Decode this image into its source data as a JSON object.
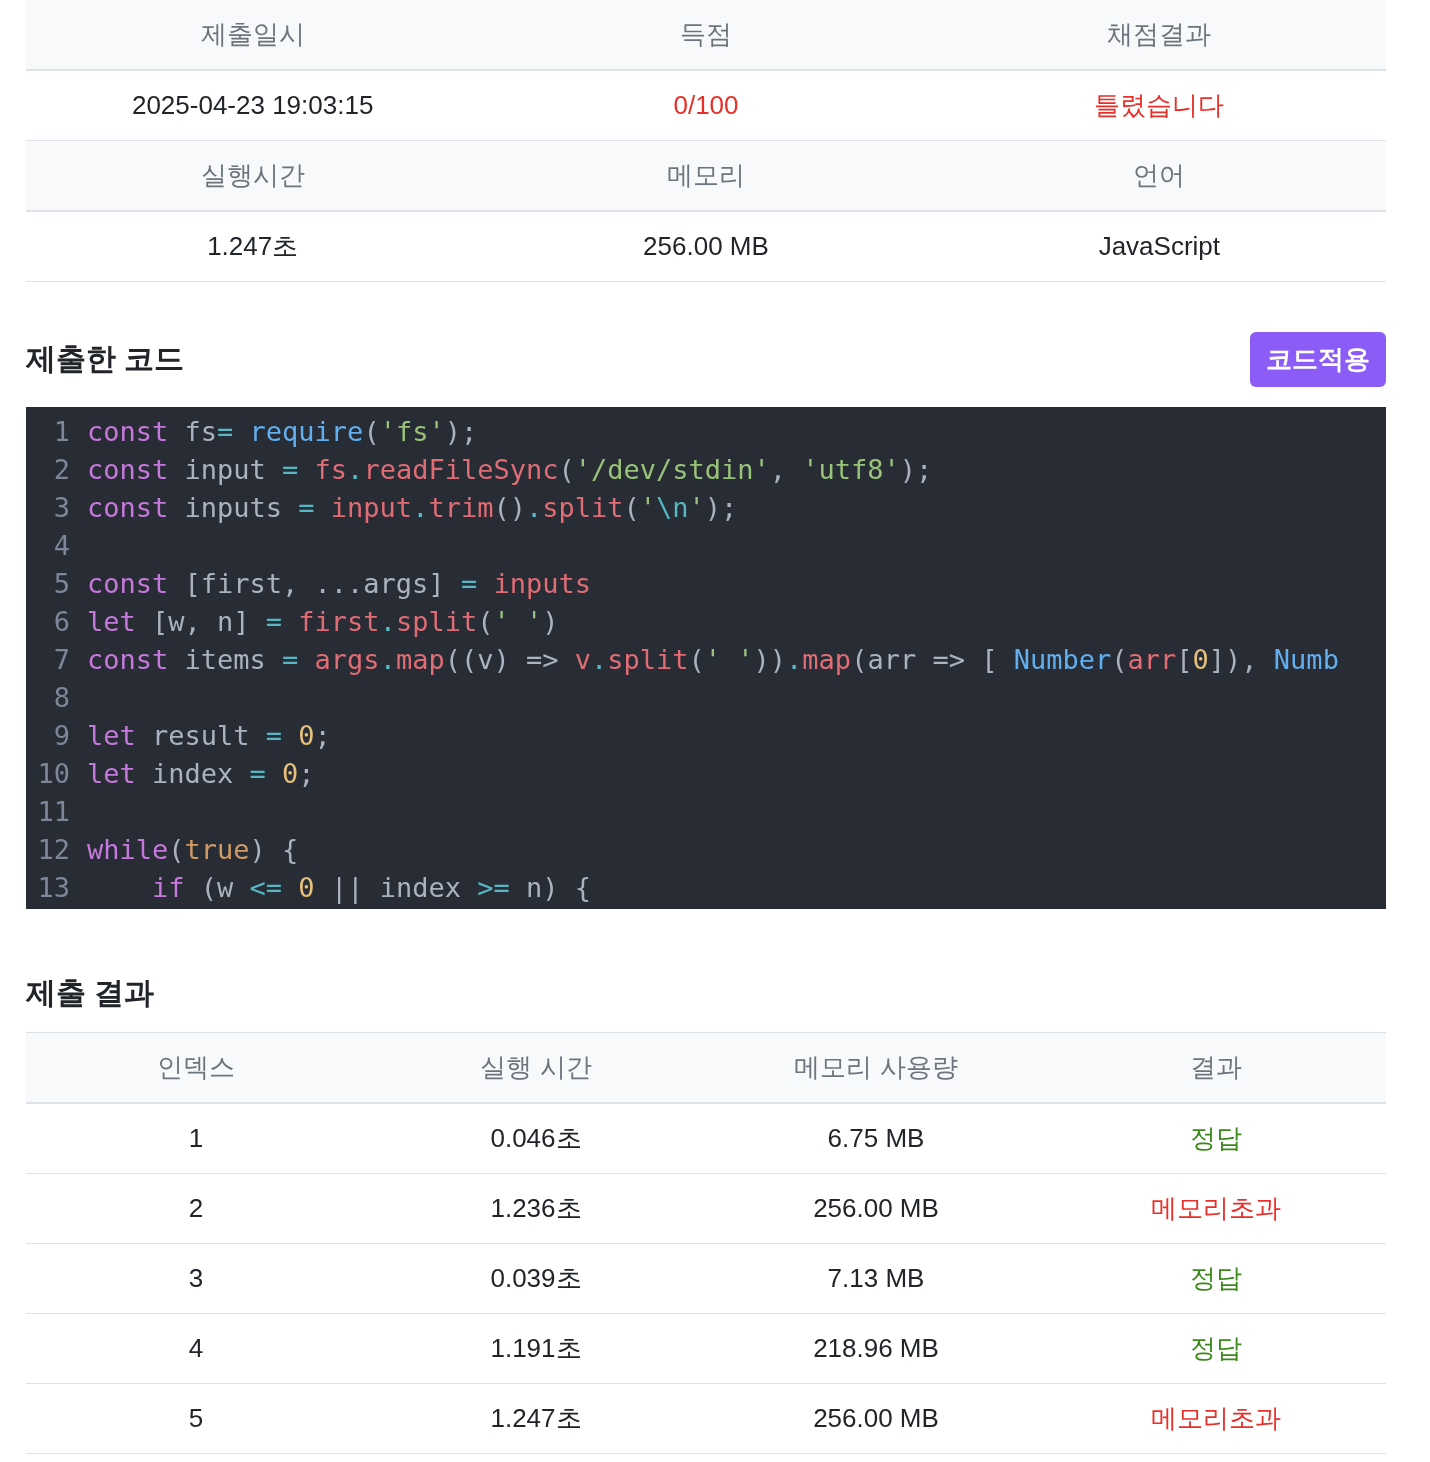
{
  "summary_table": {
    "rows": [
      {
        "kind": "header",
        "cells": [
          {
            "text": "제출일시"
          },
          {
            "text": "득점"
          },
          {
            "text": "채점결과"
          }
        ]
      },
      {
        "kind": "data",
        "cells": [
          {
            "text": "2025-04-23 19:03:15"
          },
          {
            "text": "0/100",
            "color": "#e8302a"
          },
          {
            "text": "틀렸습니다",
            "color": "#e8302a"
          }
        ]
      },
      {
        "kind": "header",
        "cells": [
          {
            "text": "실행시간"
          },
          {
            "text": "메모리"
          },
          {
            "text": "언어"
          }
        ]
      },
      {
        "kind": "data",
        "cells": [
          {
            "text": "1.247초"
          },
          {
            "text": "256.00 MB"
          },
          {
            "text": "JavaScript"
          }
        ]
      }
    ]
  },
  "code_section": {
    "title": "제출한 코드",
    "button": "코드적용",
    "lines": [
      {
        "number": "1",
        "tokens": [
          {
            "kind": "keyword",
            "text": "const"
          },
          {
            "kind": "plain",
            "text": " fs"
          },
          {
            "kind": "op",
            "text": "= "
          },
          {
            "kind": "builtin",
            "text": "require"
          },
          {
            "kind": "plain",
            "text": "("
          },
          {
            "kind": "string",
            "text": "'fs'"
          },
          {
            "kind": "plain",
            "text": ");"
          }
        ]
      },
      {
        "number": "2",
        "tokens": [
          {
            "kind": "keyword",
            "text": "const"
          },
          {
            "kind": "plain",
            "text": " input "
          },
          {
            "kind": "op",
            "text": "= "
          },
          {
            "kind": "name",
            "text": "fs"
          },
          {
            "kind": "op",
            "text": "."
          },
          {
            "kind": "name",
            "text": "readFileSync"
          },
          {
            "kind": "plain",
            "text": "("
          },
          {
            "kind": "string",
            "text": "'/dev/stdin'"
          },
          {
            "kind": "plain",
            "text": ", "
          },
          {
            "kind": "string",
            "text": "'utf8'"
          },
          {
            "kind": "plain",
            "text": ");"
          }
        ]
      },
      {
        "number": "3",
        "tokens": [
          {
            "kind": "keyword",
            "text": "const"
          },
          {
            "kind": "plain",
            "text": " inputs "
          },
          {
            "kind": "op",
            "text": "= "
          },
          {
            "kind": "name",
            "text": "input"
          },
          {
            "kind": "op",
            "text": "."
          },
          {
            "kind": "name",
            "text": "trim"
          },
          {
            "kind": "plain",
            "text": "()"
          },
          {
            "kind": "op",
            "text": "."
          },
          {
            "kind": "name",
            "text": "split"
          },
          {
            "kind": "plain",
            "text": "("
          },
          {
            "kind": "string",
            "text": "'"
          },
          {
            "kind": "op",
            "text": "\\n"
          },
          {
            "kind": "string",
            "text": "'"
          },
          {
            "kind": "plain",
            "text": ");"
          }
        ]
      },
      {
        "number": "4"
      },
      {
        "number": "5",
        "tokens": [
          {
            "kind": "keyword",
            "text": "const"
          },
          {
            "kind": "plain",
            "text": " [first, ...args] "
          },
          {
            "kind": "op",
            "text": "= "
          },
          {
            "kind": "name",
            "text": "inputs"
          }
        ]
      },
      {
        "number": "6",
        "tokens": [
          {
            "kind": "keyword",
            "text": "let"
          },
          {
            "kind": "plain",
            "text": " [w, n] "
          },
          {
            "kind": "op",
            "text": "= "
          },
          {
            "kind": "name",
            "text": "first"
          },
          {
            "kind": "op",
            "text": "."
          },
          {
            "kind": "name",
            "text": "split"
          },
          {
            "kind": "plain",
            "text": "("
          },
          {
            "kind": "string",
            "text": "' '"
          },
          {
            "kind": "plain",
            "text": ")"
          }
        ]
      },
      {
        "number": "7",
        "tokens": [
          {
            "kind": "keyword",
            "text": "const"
          },
          {
            "kind": "plain",
            "text": " items "
          },
          {
            "kind": "op",
            "text": "= "
          },
          {
            "kind": "name",
            "text": "args"
          },
          {
            "kind": "op",
            "text": "."
          },
          {
            "kind": "name",
            "text": "map"
          },
          {
            "kind": "plain",
            "text": "((v) => "
          },
          {
            "kind": "name",
            "text": "v"
          },
          {
            "kind": "op",
            "text": "."
          },
          {
            "kind": "name",
            "text": "split"
          },
          {
            "kind": "plain",
            "text": "("
          },
          {
            "kind": "string",
            "text": "' '"
          },
          {
            "kind": "plain",
            "text": "))"
          },
          {
            "kind": "op",
            "text": "."
          },
          {
            "kind": "name",
            "text": "map"
          },
          {
            "kind": "plain",
            "text": "(arr => [ "
          },
          {
            "kind": "builtin",
            "text": "Number"
          },
          {
            "kind": "plain",
            "text": "("
          },
          {
            "kind": "name",
            "text": "arr"
          },
          {
            "kind": "plain",
            "text": "["
          },
          {
            "kind": "number",
            "text": "0"
          },
          {
            "kind": "plain",
            "text": "]), "
          },
          {
            "kind": "builtin",
            "text": "Numb"
          }
        ]
      },
      {
        "number": "8"
      },
      {
        "number": "9",
        "tokens": [
          {
            "kind": "keyword",
            "text": "let"
          },
          {
            "kind": "plain",
            "text": " result "
          },
          {
            "kind": "op",
            "text": "= "
          },
          {
            "kind": "number",
            "text": "0"
          },
          {
            "kind": "plain",
            "text": ";"
          }
        ]
      },
      {
        "number": "10",
        "tokens": [
          {
            "kind": "keyword",
            "text": "let"
          },
          {
            "kind": "plain",
            "text": " index "
          },
          {
            "kind": "op",
            "text": "= "
          },
          {
            "kind": "number",
            "text": "0"
          },
          {
            "kind": "plain",
            "text": ";"
          }
        ]
      },
      {
        "number": "11"
      },
      {
        "number": "12",
        "tokens": [
          {
            "kind": "keyword",
            "text": "while"
          },
          {
            "kind": "plain",
            "text": "("
          },
          {
            "kind": "literal",
            "text": "true"
          },
          {
            "kind": "plain",
            "text": ") {"
          }
        ]
      },
      {
        "number": "13",
        "tokens": [
          {
            "kind": "keyword",
            "text": "    if"
          },
          {
            "kind": "plain",
            "text": " (w "
          },
          {
            "kind": "op",
            "text": "<= "
          },
          {
            "kind": "number",
            "text": "0"
          },
          {
            "kind": "plain",
            "text": " || index "
          },
          {
            "kind": "op",
            "text": ">= "
          },
          {
            "kind": "plain",
            "text": "n) {"
          }
        ]
      }
    ]
  },
  "results_section": {
    "title": "제출 결과",
    "columns": [
      "인덱스",
      "실행 시간",
      "메모리 사용량",
      "결과"
    ],
    "rows": [
      {
        "index": "1",
        "time": "0.046초",
        "memory": "6.75 MB",
        "result": "정답",
        "color": "#3c8a1c"
      },
      {
        "index": "2",
        "time": "1.236초",
        "memory": "256.00 MB",
        "result": "메모리초과",
        "color": "#e8302a"
      },
      {
        "index": "3",
        "time": "0.039초",
        "memory": "7.13 MB",
        "result": "정답",
        "color": "#3c8a1c"
      },
      {
        "index": "4",
        "time": "1.191초",
        "memory": "218.96 MB",
        "result": "정답",
        "color": "#3c8a1c"
      },
      {
        "index": "5",
        "time": "1.247초",
        "memory": "256.00 MB",
        "result": "메모리초과",
        "color": "#e8302a"
      }
    ]
  }
}
